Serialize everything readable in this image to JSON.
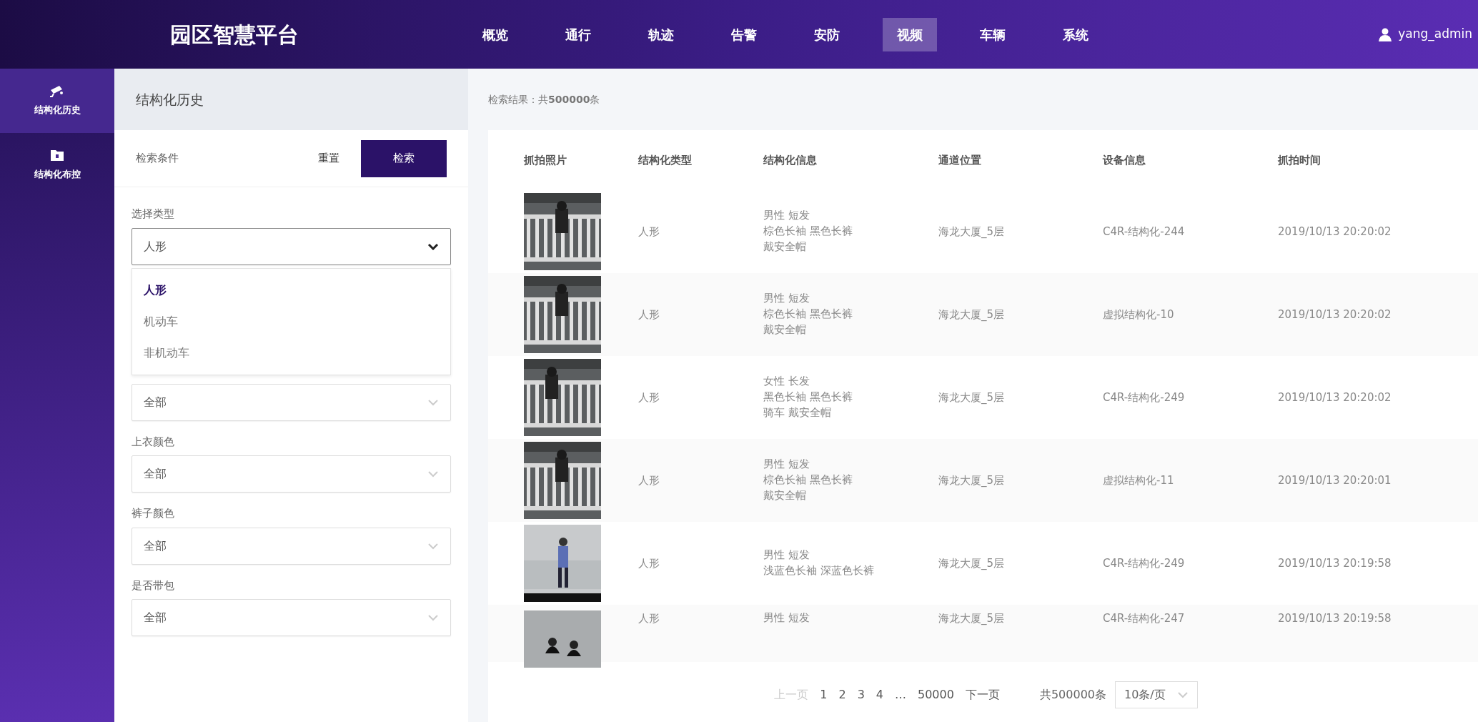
{
  "header": {
    "title": "园区智慧平台",
    "nav": [
      {
        "label": "概览",
        "selected": false
      },
      {
        "label": "通行",
        "selected": false
      },
      {
        "label": "轨迹",
        "selected": false
      },
      {
        "label": "告警",
        "selected": false
      },
      {
        "label": "安防",
        "selected": false
      },
      {
        "label": "视频",
        "selected": true
      },
      {
        "label": "车辆",
        "selected": false
      },
      {
        "label": "系统",
        "selected": false
      }
    ],
    "user": "yang_admin"
  },
  "sidebar": {
    "items": [
      {
        "label": "结构化历史",
        "kind": "camera",
        "selected": true
      },
      {
        "label": "结构化布控",
        "kind": "folder",
        "selected": false
      }
    ]
  },
  "filter_panel": {
    "title": "结构化历史",
    "conditions_label": "检索条件",
    "reset": "重置",
    "search": "检索",
    "fields": [
      {
        "label": "选择类型",
        "value": "人形",
        "expanded": true,
        "options": [
          {
            "label": "人形",
            "selected": true
          },
          {
            "label": "机动车",
            "selected": false
          },
          {
            "label": "非机动车",
            "selected": false
          }
        ]
      },
      {
        "value": "全部",
        "expanded": false
      },
      {
        "label": "上衣颜色",
        "value": "全部",
        "expanded": false
      },
      {
        "label": "裤子颜色",
        "value": "全部",
        "expanded": false
      },
      {
        "label": "是否带包",
        "value": "全部",
        "expanded": false
      }
    ]
  },
  "results": {
    "summary": "检索结果：共**500000**条",
    "table": {
      "columns": [
        "抓拍照片",
        "结构化类型",
        "结构化信息",
        "通道位置",
        "设备信息",
        "抓拍时间"
      ],
      "rows": [
        {
          "photo": {
            "kind": "picture"
          },
          "type": "人形",
          "info": [
            "男性 短发",
            "棕色长袖 黑色长裤",
            "戴安全帽"
          ],
          "location": "海龙大厦_5层",
          "device": "C4R-结构化-244",
          "time": "2019/10/13 20:20:02"
        },
        {
          "photo": {
            "kind": "picture"
          },
          "type": "人形",
          "info": [
            "男性 短发",
            "棕色长袖 黑色长裤",
            "戴安全帽"
          ],
          "location": "海龙大厦_5层",
          "device": "虚拟结构化-10",
          "time": "2019/10/13 20:20:02"
        },
        {
          "photo": {
            "kind": "picture"
          },
          "type": "人形",
          "info": [
            "女性 长发",
            "黑色长袖 黑色长裤",
            "骑车 戴安全帽"
          ],
          "location": "海龙大厦_5层",
          "device": "C4R-结构化-249",
          "time": "2019/10/13 20:20:02"
        },
        {
          "photo": {
            "kind": "picture"
          },
          "type": "人形",
          "info": [
            "男性 短发",
            "棕色长袖 黑色长裤",
            "戴安全帽"
          ],
          "location": "海龙大厦_5层",
          "device": "虚拟结构化-11",
          "time": "2019/10/13 20:20:01"
        },
        {
          "photo": {
            "kind": "picture"
          },
          "type": "人形",
          "info": [
            "男性 短发",
            "浅蓝色长袖 深蓝色长裤"
          ],
          "location": "海龙大厦_5层",
          "device": "C4R-结构化-249",
          "time": "2019/10/13 20:19:58"
        },
        {
          "photo": {
            "kind": "picture"
          },
          "type": "人形",
          "info": [
            "男性 短发"
          ],
          "location": "海龙大厦_5层",
          "device": "C4R-结构化-247",
          "time": "2019/10/13 20:19:58"
        }
      ]
    },
    "pagination": {
      "prev": {
        "label": "上一页",
        "disabled": true
      },
      "pages": [
        {
          "label": "1",
          "selected": false
        },
        {
          "label": "2",
          "selected": false
        },
        {
          "label": "3",
          "selected": false
        },
        {
          "label": "4",
          "selected": false
        },
        {
          "label": "…",
          "selected": false
        },
        {
          "label": "50000",
          "selected": false
        }
      ],
      "next": {
        "label": "下一页",
        "disabled": false
      },
      "total": "共500000条",
      "page_size": "10条/页"
    }
  }
}
